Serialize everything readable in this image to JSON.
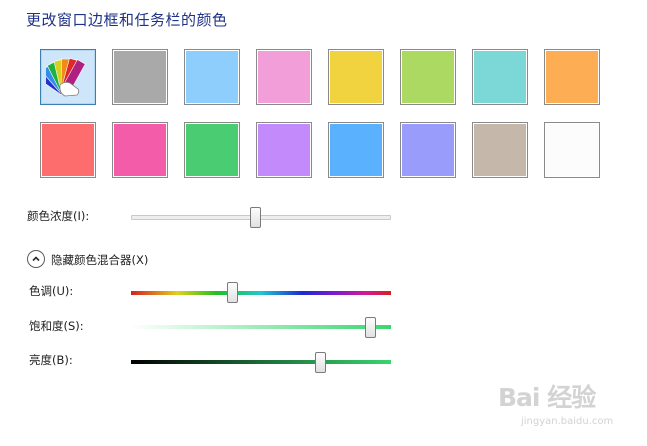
{
  "title": "更改窗口边框和任务栏的颜色",
  "swatches": [
    {
      "name": "custom",
      "color": "#cfe6fa",
      "icon": "color-palette-icon",
      "selected": true
    },
    {
      "name": "gray",
      "color": "#a9a9a9"
    },
    {
      "name": "sky-blue",
      "color": "#8ecefc"
    },
    {
      "name": "pink",
      "color": "#f29ed8"
    },
    {
      "name": "yellow",
      "color": "#f1d340"
    },
    {
      "name": "lime",
      "color": "#abd961"
    },
    {
      "name": "teal",
      "color": "#7cd8d7"
    },
    {
      "name": "orange",
      "color": "#fdad54"
    },
    {
      "name": "red",
      "color": "#fd6d6d"
    },
    {
      "name": "magenta",
      "color": "#f25ca8"
    },
    {
      "name": "green",
      "color": "#4acd72"
    },
    {
      "name": "violet",
      "color": "#c38afc"
    },
    {
      "name": "blue",
      "color": "#5ab1fd"
    },
    {
      "name": "periwinkle",
      "color": "#9a9cfc"
    },
    {
      "name": "taupe",
      "color": "#c5b8ab"
    },
    {
      "name": "white",
      "color": "#fcfcfc"
    }
  ],
  "intensity": {
    "label": "颜色浓度(I):",
    "value_fraction": 0.48
  },
  "mixer_toggle": {
    "label": "隐藏颜色混合器(X)",
    "icon": "chevron-up-icon",
    "expanded": true
  },
  "hue": {
    "label": "色调(U):",
    "value_fraction": 0.39
  },
  "saturation": {
    "label": "饱和度(S):",
    "value_fraction": 0.92
  },
  "brightness": {
    "label": "亮度(B):",
    "value_fraction": 0.73
  },
  "mixer_color": "#38d670",
  "watermark": {
    "main": "Bai 经验",
    "sub": "jingyan.baidu.com"
  }
}
